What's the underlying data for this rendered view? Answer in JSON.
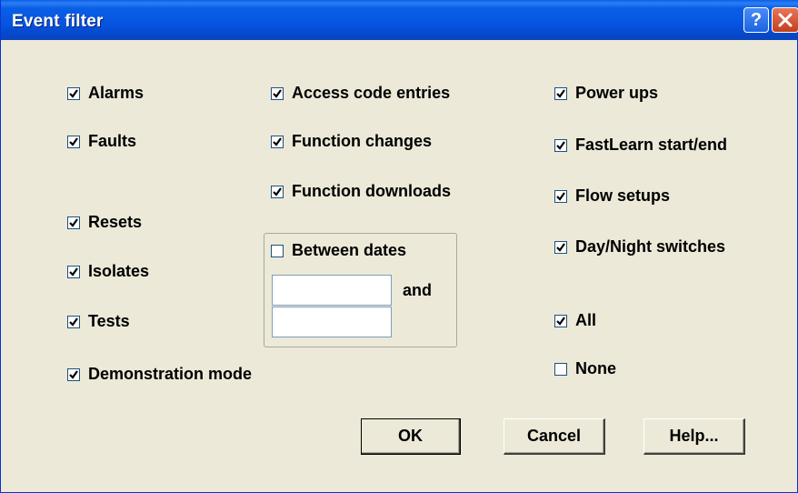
{
  "window": {
    "title": "Event filter"
  },
  "title_buttons": {
    "help_glyph": "?",
    "close_glyph": "X"
  },
  "checkboxes": {
    "alarms": {
      "label": "Alarms",
      "checked": true
    },
    "faults": {
      "label": "Faults",
      "checked": true
    },
    "resets": {
      "label": "Resets",
      "checked": true
    },
    "isolates": {
      "label": "Isolates",
      "checked": true
    },
    "tests": {
      "label": "Tests",
      "checked": true
    },
    "demonstration_mode": {
      "label": "Demonstration mode",
      "checked": true
    },
    "access_code_entries": {
      "label": "Access code entries",
      "checked": true
    },
    "function_changes": {
      "label": "Function changes",
      "checked": true
    },
    "function_downloads": {
      "label": "Function downloads",
      "checked": true
    },
    "between_dates": {
      "label": "Between dates",
      "checked": false
    },
    "power_ups": {
      "label": "Power ups",
      "checked": true
    },
    "fastlearn": {
      "label": "FastLearn start/end",
      "checked": true
    },
    "flow_setups": {
      "label": "Flow setups",
      "checked": true
    },
    "day_night": {
      "label": "Day/Night switches",
      "checked": true
    },
    "all": {
      "label": "All",
      "checked": true
    },
    "none": {
      "label": "None",
      "checked": false
    }
  },
  "dates": {
    "and_label": "and",
    "start_value": "",
    "end_value": ""
  },
  "buttons": {
    "ok": "OK",
    "cancel": "Cancel",
    "help": "Help..."
  },
  "colors": {
    "titlebar": "#0654E0",
    "dialog_bg": "#ECE9D8",
    "checkbox_border": "#1C5180",
    "close_button": "#C1401E"
  }
}
